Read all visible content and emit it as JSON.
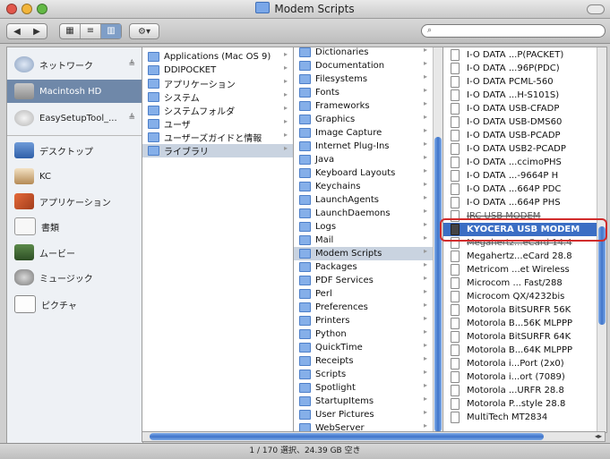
{
  "window": {
    "title": "Modem Scripts"
  },
  "toolbar": {
    "back": "◀",
    "forward": "▶",
    "view_icons": "▦",
    "view_list": "≡",
    "view_columns": "▥",
    "action": "⚙▾",
    "search_placeholder": ""
  },
  "sidebar": {
    "items": [
      {
        "label": "ネットワーク",
        "eject": "≜"
      },
      {
        "label": "Macintosh HD",
        "eject": ""
      },
      {
        "label": "EasySetupTool_...",
        "eject": "≜"
      },
      {
        "label": "デスクトップ",
        "eject": ""
      },
      {
        "label": "KC",
        "eject": ""
      },
      {
        "label": "アプリケーション",
        "eject": ""
      },
      {
        "label": "書類",
        "eject": ""
      },
      {
        "label": "ムービー",
        "eject": ""
      },
      {
        "label": "ミュージック",
        "eject": ""
      },
      {
        "label": "ピクチャ",
        "eject": ""
      }
    ]
  },
  "column1": {
    "items": [
      "Applications (Mac OS 9)",
      "DDIPOCKET",
      "アプリケーション",
      "システム",
      "システムフォルダ",
      "ユーザ",
      "ユーザーズガイドと情報",
      "ライブラリ"
    ]
  },
  "column2": {
    "items": [
      "Dictionaries",
      "Documentation",
      "Filesystems",
      "Fonts",
      "Frameworks",
      "Graphics",
      "Image Capture",
      "Internet Plug-Ins",
      "Java",
      "Keyboard Layouts",
      "Keychains",
      "LaunchAgents",
      "LaunchDaemons",
      "Logs",
      "Mail",
      "Modem Scripts",
      "Packages",
      "PDF Services",
      "Perl",
      "Preferences",
      "Printers",
      "Python",
      "QuickTime",
      "Receipts",
      "Scripts",
      "Spotlight",
      "StartupItems",
      "User Pictures",
      "WebServer"
    ]
  },
  "column3": {
    "items": [
      "I-O DATA ...P(PACKET)",
      "I-O DATA ...96P(PDC)",
      "I-O DATA PCML-560",
      "I-O DATA ...H-S101S)",
      "I-O DATA USB-CFADP",
      "I-O DATA USB-DMS60",
      "I-O DATA USB-PCADP",
      "I-O DATA USB2-PCADP",
      "I-O DATA ...ccimoPHS",
      "I-O DATA ...-9664P H",
      "I-O DATA ...664P PDC",
      "I-O DATA ...664P PHS",
      "JRC USB MODEM",
      "KYOCERA USB MODEM",
      "Megahertz...eCard 14.4",
      "Megahertz...eCard 28.8",
      "Metricom ...et Wireless",
      "Microcom ... Fast/288",
      "Microcom QX/4232bis",
      "Motorola BitSURFR 56K",
      "Motorola B...56K MLPPP",
      "Motorola BitSURFR 64K",
      "Motorola B...64K MLPPP",
      "Motorola i...Port (2x0)",
      "Motorola i...ort (7089)",
      "Motorola ...URFR 28.8",
      "Motorola P...style 28.8",
      "MultiTech MT2834"
    ]
  },
  "status": {
    "text": "1 / 170 選択、24.39 GB 空き"
  }
}
